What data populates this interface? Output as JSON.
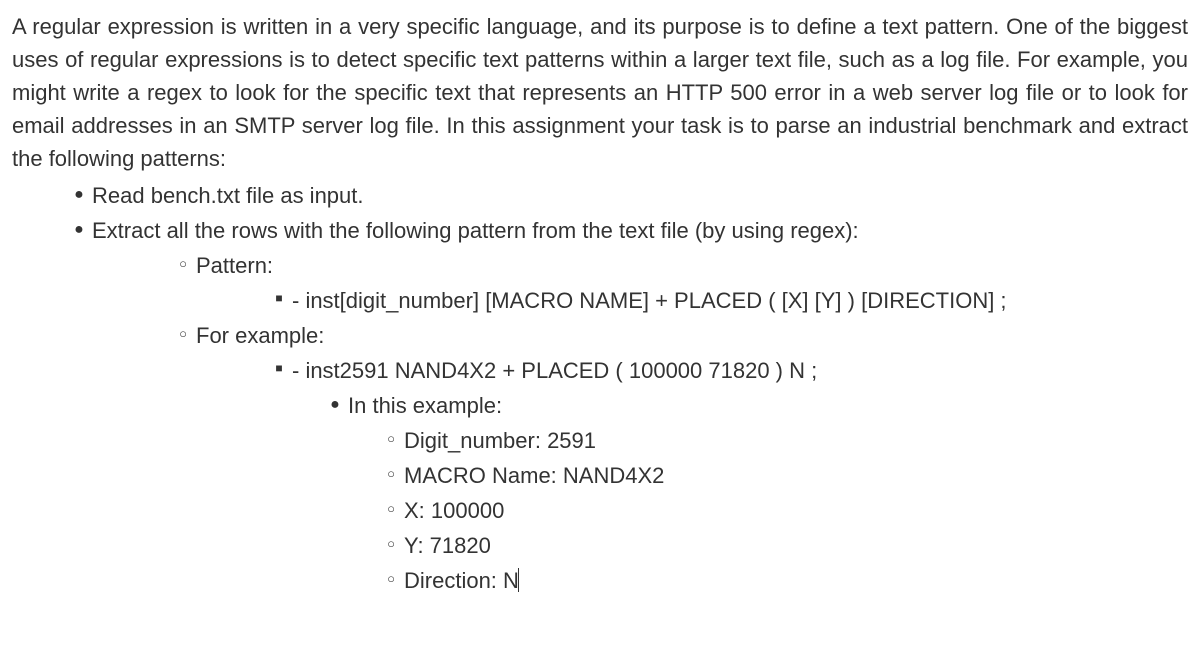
{
  "intro": "A regular expression is written in a very specific language, and its purpose is to define a text pattern. One of the biggest uses of regular expressions is to detect specific text patterns within a larger text file, such as a log file. For example, you might write a regex to look for the specific text that represents an HTTP 500 error in a web server log file or to look for email addresses in an SMTP server log file. In this assignment your task is to parse an industrial benchmark and extract the following patterns:",
  "lvl1": {
    "item1": "Read bench.txt file as input.",
    "item2": "Extract all the rows with the following pattern from the text file (by using regex):"
  },
  "lvl2": {
    "pattern_label": "Pattern:",
    "example_label": "For example:"
  },
  "lvl3": {
    "pattern_text": "- inst[digit_number] [MACRO NAME] + PLACED ( [X]  [Y] ) [DIRECTION] ;",
    "example_text": "- inst2591 NAND4X2 + PLACED ( 100000 71820 ) N ;"
  },
  "lvl4": {
    "in_this_example": "In this example:"
  },
  "lvl5": {
    "digit_number": "Digit_number: 2591",
    "macro_name": "MACRO Name: NAND4X2",
    "x": "X: 100000",
    "y": "Y: 71820",
    "direction": "Direction: N"
  }
}
